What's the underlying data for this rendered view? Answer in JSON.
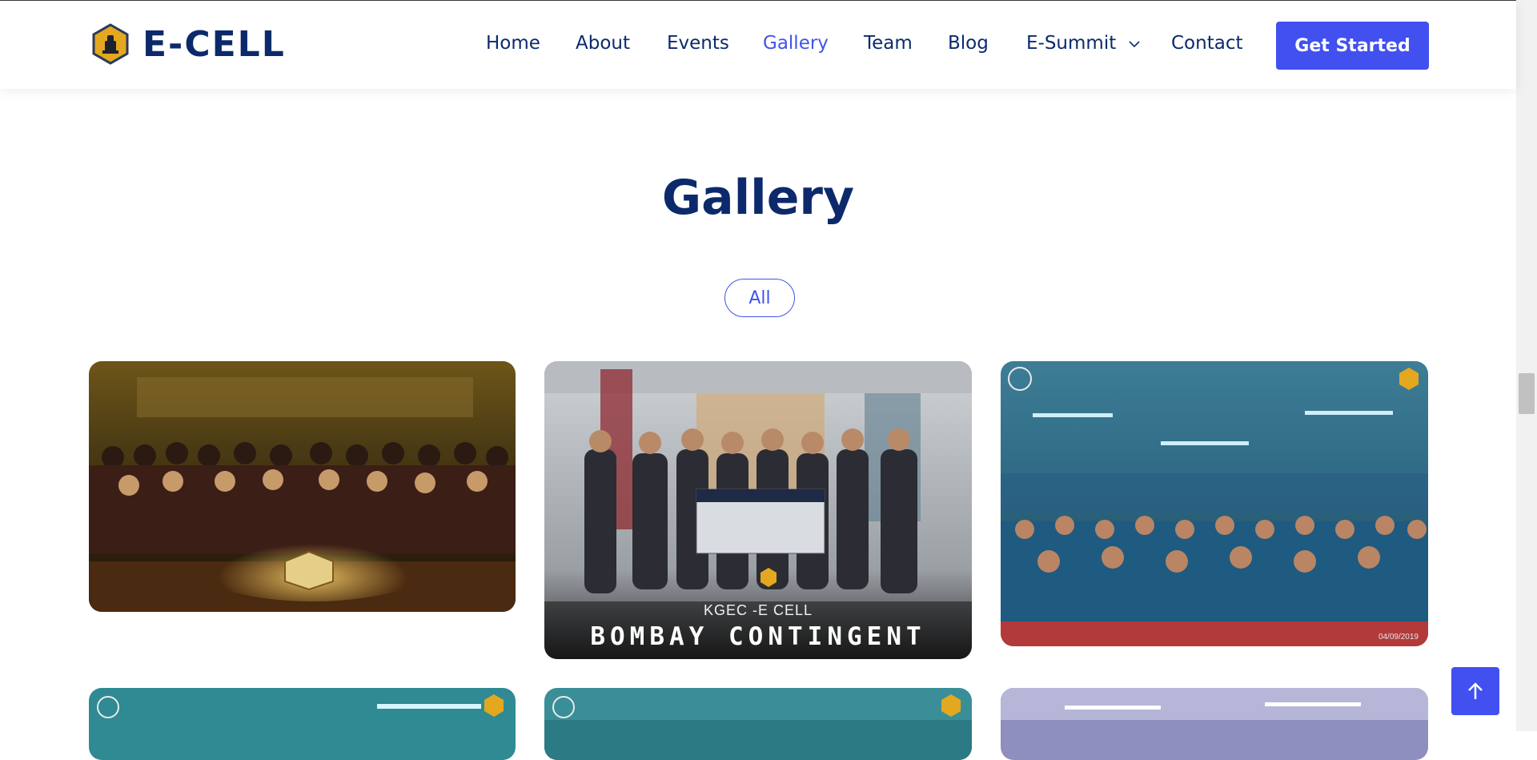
{
  "header": {
    "logo_text": "E-CELL",
    "nav": [
      {
        "label": "Home"
      },
      {
        "label": "About"
      },
      {
        "label": "Events"
      },
      {
        "label": "Gallery",
        "active": true
      },
      {
        "label": "Team"
      },
      {
        "label": "Blog"
      },
      {
        "label": "E-Summit",
        "dropdown": true
      },
      {
        "label": "Contact"
      }
    ],
    "cta_label": "Get Started"
  },
  "main": {
    "title": "Gallery",
    "filter_label": "All",
    "photos": [
      {
        "description": "cake-celebration-photo"
      },
      {
        "description": "bombay-contingent-photo",
        "caption_small": "KGEC -E CELL",
        "caption_big": "BOMBAY CONTINGENT"
      },
      {
        "description": "audience-group-photo",
        "date_stamp": "04/09/2019"
      },
      {
        "description": "hall-photo-4"
      },
      {
        "description": "hall-photo-5"
      },
      {
        "description": "hall-photo-6"
      }
    ]
  },
  "colors": {
    "brand_navy": "#0c2a6b",
    "accent": "#4150ef",
    "logo_gold": "#e3a81f"
  },
  "icons": [
    "hexagon-logo-icon",
    "chevron-down-icon",
    "arrow-up-icon",
    "college-seal-icon"
  ]
}
